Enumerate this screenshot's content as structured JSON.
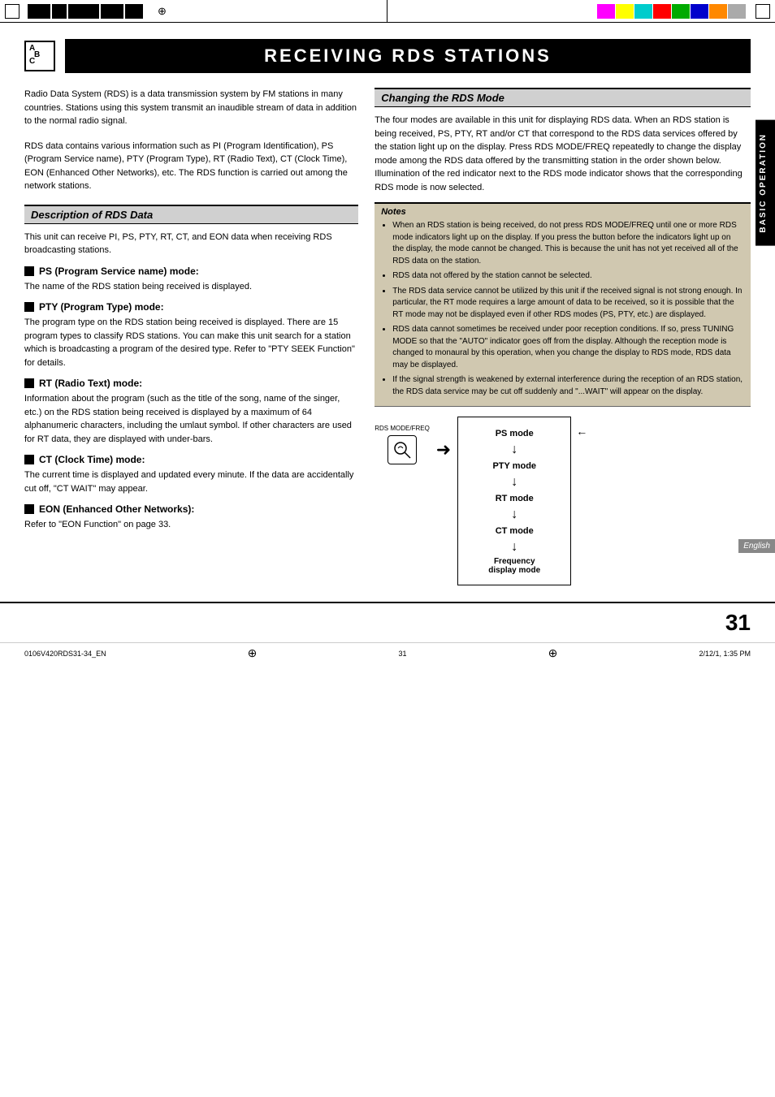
{
  "topBar": {
    "colorBlocks": [
      "#ff00ff",
      "#ffff00",
      "#00ffff",
      "#ff0000",
      "#00cc00",
      "#0000ff",
      "#ff8800",
      "#aaaaaa"
    ]
  },
  "page": {
    "abcLabel": "ABC",
    "title": "RECEIVING RDS STATIONS",
    "introText1": "Radio Data System (RDS) is a data transmission system by FM stations in many countries. Stations using this system transmit an inaudible stream of data in addition to the normal radio signal.",
    "introText2": "RDS data contains various information such as PI (Program Identification), PS (Program Service name), PTY (Program Type), RT (Radio Text), CT (Clock Time), EON (Enhanced Other Networks), etc. The RDS function is carried out among the network stations.",
    "descriptionHeader": "Description of RDS Data",
    "descriptionText": "This unit can receive PI, PS, PTY, RT, CT, and EON data when receiving RDS broadcasting stations.",
    "modes": [
      {
        "heading": "PS (Program Service name) mode:",
        "text": "The name of the RDS station being received is displayed."
      },
      {
        "heading": "PTY (Program Type) mode:",
        "text": "The program type on the RDS station being received is displayed. There are 15 program types to classify RDS stations. You can make this unit search for a station which is broadcasting a program of the desired type. Refer to \"PTY SEEK Function\" for details."
      },
      {
        "heading": "RT (Radio Text) mode:",
        "text": "Information about the program (such as the title of the song, name of the singer, etc.) on the RDS station being received is displayed by a maximum of 64 alphanumeric characters, including the umlaut symbol. If other characters are used for RT data, they are displayed with under-bars."
      },
      {
        "heading": "CT (Clock Time) mode:",
        "text": "The current time is displayed and updated every minute. If the data are accidentally cut off, \"CT WAIT\" may appear."
      },
      {
        "heading": "EON (Enhanced Other Networks):",
        "text": "Refer to \"EON Function\" on page 33."
      }
    ],
    "changingHeader": "Changing the RDS Mode",
    "changingText": "The four modes are available in this unit for displaying RDS data. When an RDS station is being received, PS, PTY, RT and/or CT that correspond to the RDS data services offered by the station light up on the display. Press RDS MODE/FREQ repeatedly to change the display mode among the RDS data offered by the transmitting station in the order shown below. Illumination of the red indicator next to the RDS mode indicator shows that the corresponding RDS mode is now selected.",
    "notesTitle": "Notes",
    "notes": [
      "When an RDS station is being received, do not press RDS MODE/FREQ until one or more RDS mode indicators light up on the display. If you press the button before the indicators light up on the display, the mode cannot be changed. This is because the unit has not yet received all of the RDS data on the station.",
      "RDS data not offered by the station cannot be selected.",
      "The RDS data service cannot be utilized by this unit if the received signal is not strong enough. In particular, the RT mode requires a large amount of data to be received, so it is possible that the RT mode may not be displayed even if other RDS modes (PS, PTY, etc.) are displayed.",
      "RDS data cannot sometimes be received under poor reception conditions. If so, press TUNING MODE so that the \"AUTO\" indicator goes off from the display. Although the reception mode is changed to monaural by this operation, when you change the display to RDS mode, RDS data may be displayed.",
      "If the signal strength is weakened by external interference during the reception of an RDS station, the RDS data service may be cut off suddenly and \"...WAIT\" will appear on the display."
    ],
    "diagram": {
      "buttonLabel": "RDS MODE/FREQ",
      "flowItems": [
        "PS mode",
        "PTY mode",
        "RT mode",
        "CT mode",
        "Frequency\ndisplay mode"
      ]
    },
    "rightTab": "BASIC OPERATION",
    "bottomTab": "English",
    "pageNumber": "31",
    "footerLeft": "0106V420RDS31-34_EN",
    "footerCenter": "31",
    "footerRight": "2/12/1, 1:35 PM"
  }
}
